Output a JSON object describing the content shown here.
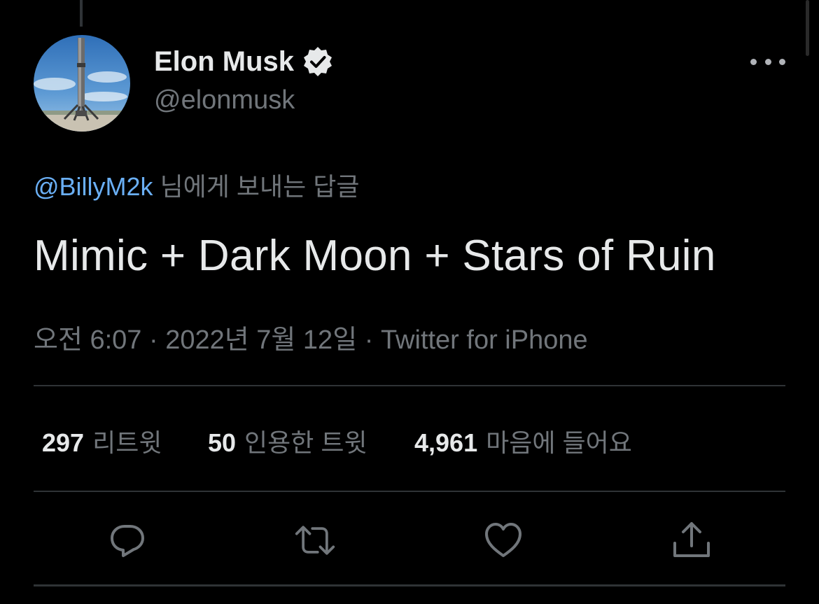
{
  "author": {
    "display_name": "Elon Musk",
    "handle": "@elonmusk",
    "verified": true,
    "avatar_icon": "rocket-avatar-icon"
  },
  "reply": {
    "mention": "@BillyM2k",
    "suffix": " 님에게 보내는 답글"
  },
  "tweet": {
    "text": "Mimic + Dark Moon + Stars of Ruin",
    "time": "오전 6:07",
    "separator": " · ",
    "date": "2022년 7월 12일",
    "source": "Twitter for iPhone"
  },
  "stats": {
    "retweets": {
      "count": "297",
      "label": "리트윗"
    },
    "quotes": {
      "count": "50",
      "label": "인용한 트윗"
    },
    "likes": {
      "count": "4,961",
      "label": "마음에 들어요"
    }
  },
  "actions": {
    "reply_icon": "reply-icon",
    "retweet_icon": "retweet-icon",
    "like_icon": "heart-icon",
    "share_icon": "share-icon"
  },
  "colors": {
    "background": "#000000",
    "text_primary": "#e7e9ea",
    "text_secondary": "#71767b",
    "mention": "#6aaff5",
    "divider": "#2f3336"
  }
}
